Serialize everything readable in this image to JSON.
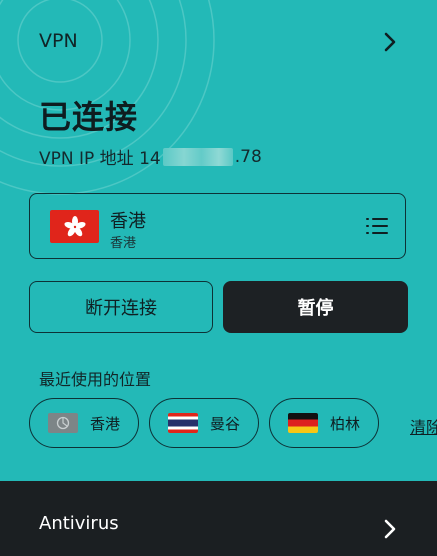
{
  "vpn": {
    "title": "VPN",
    "status": "已连接",
    "ip_label": "VPN IP 地址 14",
    "ip_suffix": ".78",
    "location": {
      "name": "香港",
      "sub": "香港"
    },
    "disconnect_label": "断开连接",
    "pause_label": "暂停",
    "recent_title": "最近使用的位置",
    "recent": [
      {
        "label": "香港",
        "flag": "hk-gray"
      },
      {
        "label": "曼谷",
        "flag": "thailand"
      },
      {
        "label": "柏林",
        "flag": "germany"
      }
    ],
    "clear_label": "清除"
  },
  "antivirus": {
    "title": "Antivirus"
  },
  "colors": {
    "background": "#23b9b7",
    "dark_button": "#1d2124",
    "antivirus_card": "#1b1f22",
    "hk_flag_red": "#e0251b"
  }
}
